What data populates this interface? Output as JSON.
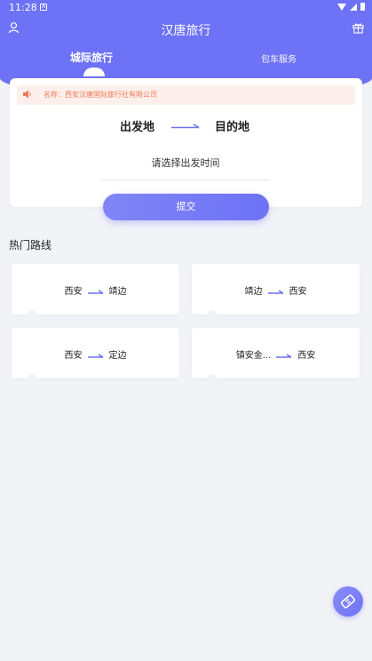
{
  "status_bar": {
    "time": "11:28",
    "notification_badge": "A"
  },
  "app_bar": {
    "title": "汉唐旅行",
    "icons": [
      "user-icon",
      "gift-icon"
    ]
  },
  "tabs": [
    {
      "label": "城际旅行",
      "active": true
    },
    {
      "label": "包车服务",
      "active": false
    }
  ],
  "notice": {
    "text": "名称：西安汉唐国际旅行社有限公司"
  },
  "booking": {
    "from": "出发地",
    "to": "目的地",
    "time_placeholder": "请选择出发时间",
    "submit_label": "提交"
  },
  "hot_routes": {
    "title": "热门路线",
    "items": [
      {
        "from": "西安",
        "to": "靖边"
      },
      {
        "from": "靖边",
        "to": "西安"
      },
      {
        "from": "西安",
        "to": "定边"
      },
      {
        "from": "镇安金...",
        "to": "西安"
      }
    ]
  },
  "colors": {
    "accent": "#6d72f6",
    "notice_text": "#ee7753",
    "background": "#f2f3f7"
  }
}
